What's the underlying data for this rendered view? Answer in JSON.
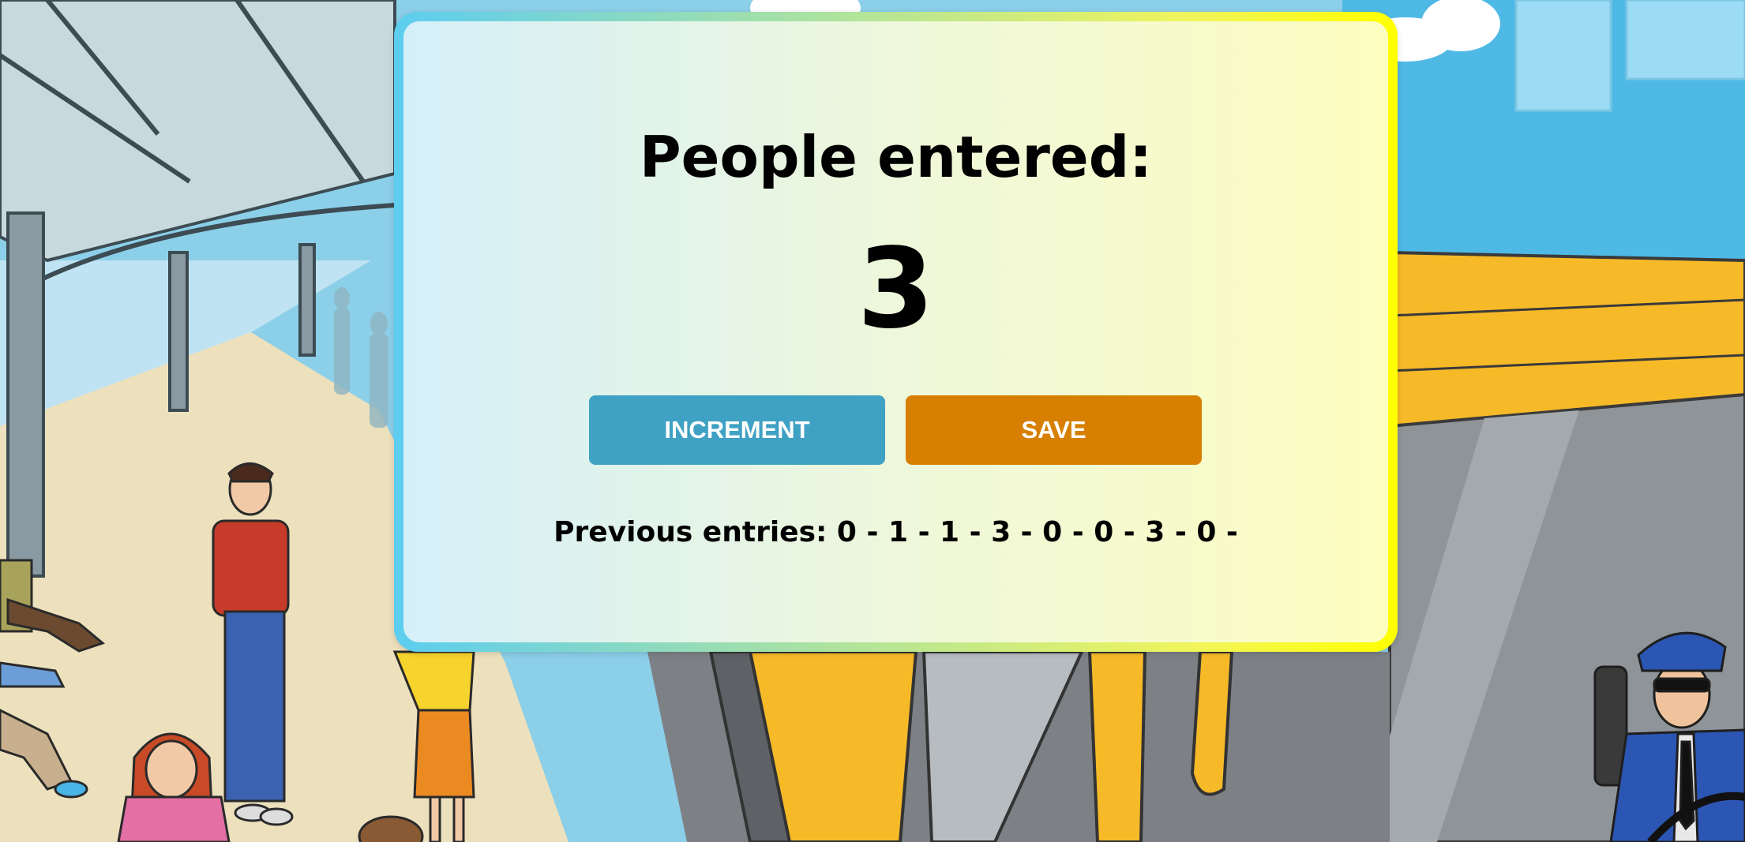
{
  "card": {
    "heading": "People entered:",
    "count": "3",
    "increment_label": "INCREMENT",
    "save_label": "SAVE",
    "previous_entries": "Previous entries: 0 - 1 - 1 - 3 - 0 - 0 - 3 - 0 -"
  },
  "colors": {
    "increment_button": "#3fa1c3",
    "save_button": "#d77f00",
    "card_border_start": "#5ccdf0",
    "card_border_end": "#ffff00"
  }
}
